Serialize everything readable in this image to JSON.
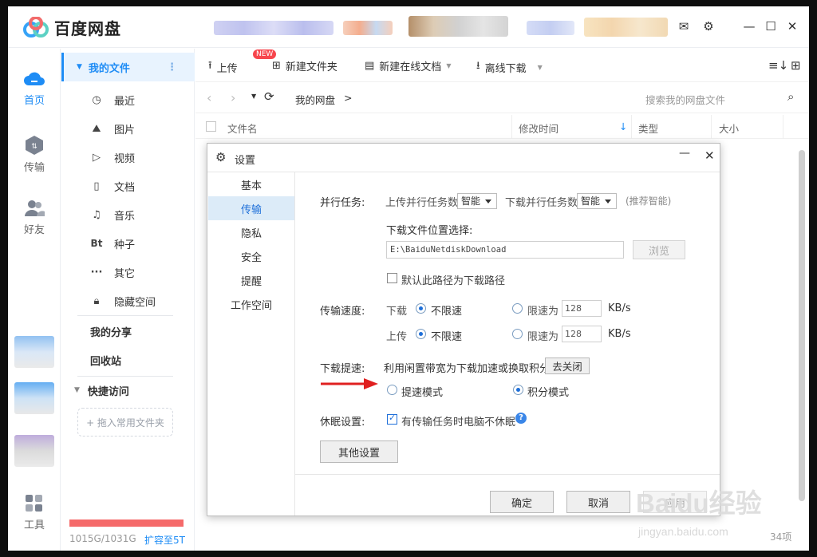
{
  "app": {
    "title": "百度网盘"
  },
  "rail": {
    "home": "首页",
    "transfer": "传输",
    "friends": "好友",
    "tools": "工具"
  },
  "sidebar": {
    "my_files": "我的文件",
    "items": [
      "最近",
      "图片",
      "视频",
      "文档",
      "音乐",
      "种子",
      "其它",
      "隐藏空间"
    ],
    "bt_glyph": "Bt",
    "my_share": "我的分享",
    "recycle": "回收站",
    "quick_access": "快捷访问",
    "add_quick": "+ 拖入常用文件夹",
    "quota": "1015G/1031G",
    "expand": "扩容至5T"
  },
  "toolbar": {
    "upload": "上传",
    "new_folder": "新建文件夹",
    "new_doc": "新建在线文档",
    "new_badge": "NEW",
    "offline": "离线下载"
  },
  "nav": {
    "breadcrumb": "我的网盘",
    "breadcrumb_sep": ">",
    "search_placeholder": "搜索我的网盘文件"
  },
  "columns": {
    "name": "文件名",
    "mtime": "修改时间",
    "type": "类型",
    "size": "大小"
  },
  "status": {
    "count": "34项"
  },
  "dialog": {
    "title": "设置",
    "nav": [
      "基本",
      "传输",
      "隐私",
      "安全",
      "提醒",
      "工作空间"
    ],
    "active_nav": "传输",
    "parallel_label": "并行任务:",
    "upload_parallel": "上传并行任务数",
    "upload_parallel_value": "智能",
    "download_parallel": "下载并行任务数",
    "download_parallel_value": "智能",
    "recommend": "(推荐智能)",
    "download_location_label": "下载文件位置选择:",
    "download_path": "E:\\BaiduNetdiskDownload",
    "browse": "浏览",
    "default_path": "默认此路径为下载路径",
    "speed_label": "传输速度:",
    "download": "下载",
    "upload": "上传",
    "unlimited": "不限速",
    "limit_to": "限速为",
    "download_limit": "128",
    "upload_limit": "128",
    "unit": "KB/s",
    "boost_label": "下载提速:",
    "boost_desc": "利用闲置带宽为下载加速或换取积分",
    "boost_close": "去关闭",
    "boost_mode": "提速模式",
    "points_mode": "积分模式",
    "sleep_label": "休眠设置:",
    "sleep_option": "有传输任务时电脑不休眠",
    "other_settings": "其他设置",
    "ok": "确定",
    "cancel": "取消",
    "apply": "应用"
  },
  "watermark": {
    "logo": "Baidu经验",
    "url": "jingyan.baidu.com"
  },
  "colors": {
    "accent": "#1e8cf5",
    "quota": "#f56a6a",
    "arrow": "#e02020"
  }
}
